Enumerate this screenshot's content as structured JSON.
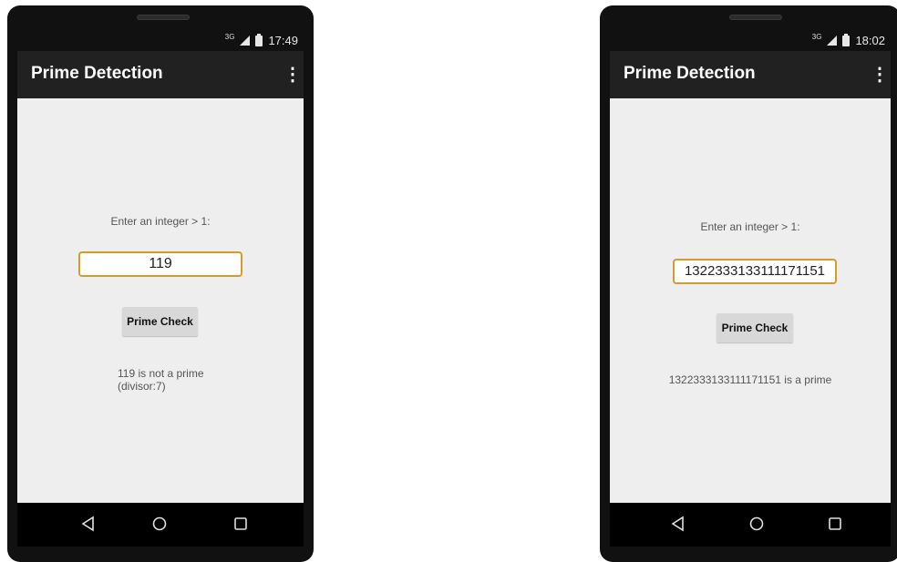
{
  "left_phone": {
    "status": {
      "network": "3G",
      "time": "17:49"
    },
    "app_title": "Prime Detection",
    "prompt": "Enter an integer > 1:",
    "input_value": "119",
    "button_label": "Prime Check",
    "result_line1": "119 is not a prime",
    "result_line2": "(divisor:7)"
  },
  "right_phone": {
    "status": {
      "network": "3G",
      "time": "18:02"
    },
    "app_title": "Prime Detection",
    "prompt": "Enter an integer > 1:",
    "input_value": "1322333133111171151",
    "button_label": "Prime Check",
    "result_line1": "1322333133111171151 is a prime"
  },
  "icons": {
    "overflow": "more-vert-icon",
    "back": "back-triangle-icon",
    "home": "home-circle-icon",
    "recents": "recents-square-icon",
    "signal": "cell-signal-icon",
    "battery": "battery-icon"
  },
  "colors": {
    "action_bar": "#212121",
    "content_bg": "#eeeeee",
    "input_focus_border": "#d89b2a",
    "button_bg": "#d8d8d8"
  }
}
